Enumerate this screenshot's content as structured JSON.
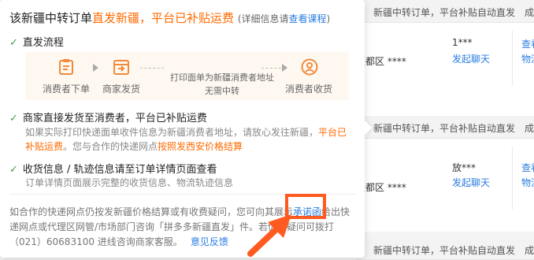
{
  "background_orders": {
    "row_note": "新疆中转订单，平台补贴自动直发",
    "row_more": "成",
    "address_suffix": "疆都区 ****",
    "chat_label": "发起聊天",
    "link1": "查看",
    "link2": "物流",
    "orders": [
      {
        "buyer": "1***"
      },
      {
        "buyer": "放***"
      }
    ]
  },
  "popover": {
    "title_prefix": "该新疆中转订单",
    "title_highlight": "直发新疆，平台已补贴运费",
    "title_paren_prefix": "(详细信息请",
    "title_link": "查看课程",
    "title_paren_suffix": ")",
    "flow_heading": "直发流程",
    "flow": {
      "step1": "消费者下单",
      "step2": "商家发货",
      "mid_line1": "打印面单为新疆消费者地址",
      "mid_line2": "无需中转",
      "step3": "消费者收货"
    },
    "item2": {
      "heading": "商家直接发货至消费者，平台已补贴运费",
      "text1": "如果实际打印快递面单收件信息为新疆消费者地址，请放心发往新疆，",
      "hl1": "平台已补贴运费",
      "text2": "。您与合作的快递网点",
      "hl2": "按照发西安价格结算"
    },
    "item3": {
      "heading": "收货信息 / 轨迹信息请至订单详情页面查看",
      "text": "订单详情页面展示完整的收货信息、物流轨迹信息"
    },
    "footer": {
      "text1": "如合作的快递网点仍按发新疆价格结算或有收费疑问，您可向其展示",
      "promise": "承诺函",
      "text2": "给出快递网点或代理区网管/市场部门咨询「拼多多新疆直发」件。若仍有疑问可拨打（021）60683100 进线咨询商家客服。",
      "feedback": "意见反馈"
    }
  },
  "accent_colors": {
    "orange": "#ff6a00",
    "link": "#2a7de1",
    "check": "#43a047",
    "highlight": "#ff5a1f"
  }
}
